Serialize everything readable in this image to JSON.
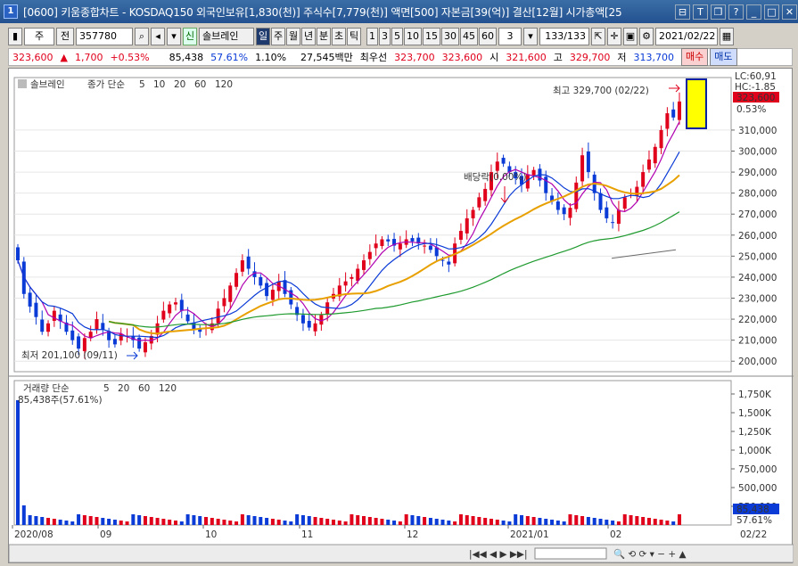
{
  "titlebar": {
    "app_badge": "1",
    "title": "[0600] 키움종합차트 - KOSDAQ150 외국인보유[1,830(천)] 주식수[7,779(천)] 액면[500] 자본금[39(억)] 결산[12월] 시가총액[25"
  },
  "toolbar": {
    "market": "주",
    "prev": "전",
    "code": "357780",
    "indicator_badge": "신",
    "name": "솔브레인",
    "periods": [
      "일",
      "주",
      "월",
      "년",
      "분",
      "초",
      "틱"
    ],
    "minutes": [
      "1",
      "3",
      "5",
      "10",
      "15",
      "30",
      "45",
      "60"
    ],
    "mult": "3",
    "count": "133/133",
    "date": "2021/02/22"
  },
  "quote": {
    "price": "323,600",
    "arrow": "▲",
    "change": "1,700",
    "pct": "+0.53%",
    "volume": "85,438",
    "vol_ratio": "57.61%",
    "turnover": "1.10%",
    "amount": "27,545백만",
    "best_label": "최우선",
    "ask": "323,700",
    "bid": "323,600",
    "open_label": "시",
    "open": "321,600",
    "high_label": "고",
    "high": "329,700",
    "low_label": "저",
    "low": "313,700",
    "buy": "매수",
    "sell": "매도"
  },
  "legend": {
    "stock": "솔브레인",
    "ma_label": "종가 단순",
    "ma_periods": [
      "5",
      "10",
      "20",
      "60",
      "120"
    ],
    "ma_colors": [
      "#b000b0",
      "#0a3bd6",
      "#e8a000",
      "#1e9a2e",
      "#6a6a6a"
    ],
    "vol_label": "거래량 단순",
    "vol_periods": [
      "5",
      "20",
      "60",
      "120"
    ],
    "vol_value": "85,438주(57.61%)"
  },
  "annotations": {
    "high": "최고 329,700 (02/22)",
    "low": "최저 201,100 (09/11)",
    "dividend": "배당락(0.00%)",
    "lc": "LC:60,91",
    "hc": "HC:-1.85",
    "last_price": "323,600",
    "last_pct": "0.53%",
    "vol_last": "85,438",
    "vol_pct": "57.61%",
    "axis_end": "02/22"
  },
  "chart_data": {
    "type": "candlestick",
    "price_axis": {
      "min": 200000,
      "max": 310000,
      "ticks": [
        "310,000",
        "300,000",
        "290,000",
        "280,000",
        "270,000",
        "260,000",
        "250,000",
        "240,000",
        "230,000",
        "220,000",
        "210,000",
        "200,000"
      ]
    },
    "volume_axis": {
      "ticks": [
        "1,750K",
        "1,500K",
        "1,250K",
        "1,000K",
        "750,000",
        "500,000",
        "250,000"
      ]
    },
    "x_labels": [
      "2020/08",
      "09",
      "10",
      "11",
      "12",
      "2021/01",
      "02"
    ],
    "closes": [
      248000,
      232000,
      226000,
      221000,
      214000,
      218000,
      224000,
      219000,
      214000,
      210000,
      206000,
      211000,
      214000,
      220000,
      215000,
      210000,
      208000,
      213000,
      212000,
      210000,
      206000,
      209000,
      212000,
      218000,
      224000,
      227000,
      228000,
      224000,
      219000,
      215000,
      214000,
      216000,
      218000,
      225000,
      230000,
      236000,
      242000,
      248000,
      244000,
      240000,
      236000,
      231000,
      234000,
      238000,
      232000,
      227000,
      222000,
      218000,
      216000,
      218000,
      222000,
      228000,
      232000,
      236000,
      238000,
      240000,
      244000,
      248000,
      252000,
      256000,
      258000,
      257000,
      255000,
      256000,
      258000,
      257000,
      256000,
      255000,
      253000,
      250000,
      248000,
      246000,
      256000,
      262000,
      268000,
      272000,
      278000,
      282000,
      290000,
      295000,
      294000,
      290000,
      287000,
      284000,
      289000,
      291000,
      286000,
      280000,
      276000,
      272000,
      270000,
      273000,
      285000,
      298000,
      290000,
      280000,
      272000,
      268000,
      266000,
      272000,
      278000,
      280000,
      283000,
      290000,
      296000,
      302000,
      310000,
      318000,
      316000,
      323600
    ],
    "series": [
      {
        "name": "5",
        "values": []
      },
      {
        "name": "10",
        "values": []
      },
      {
        "name": "20",
        "values": []
      },
      {
        "name": "60",
        "values": []
      },
      {
        "name": "120",
        "values": []
      }
    ]
  }
}
